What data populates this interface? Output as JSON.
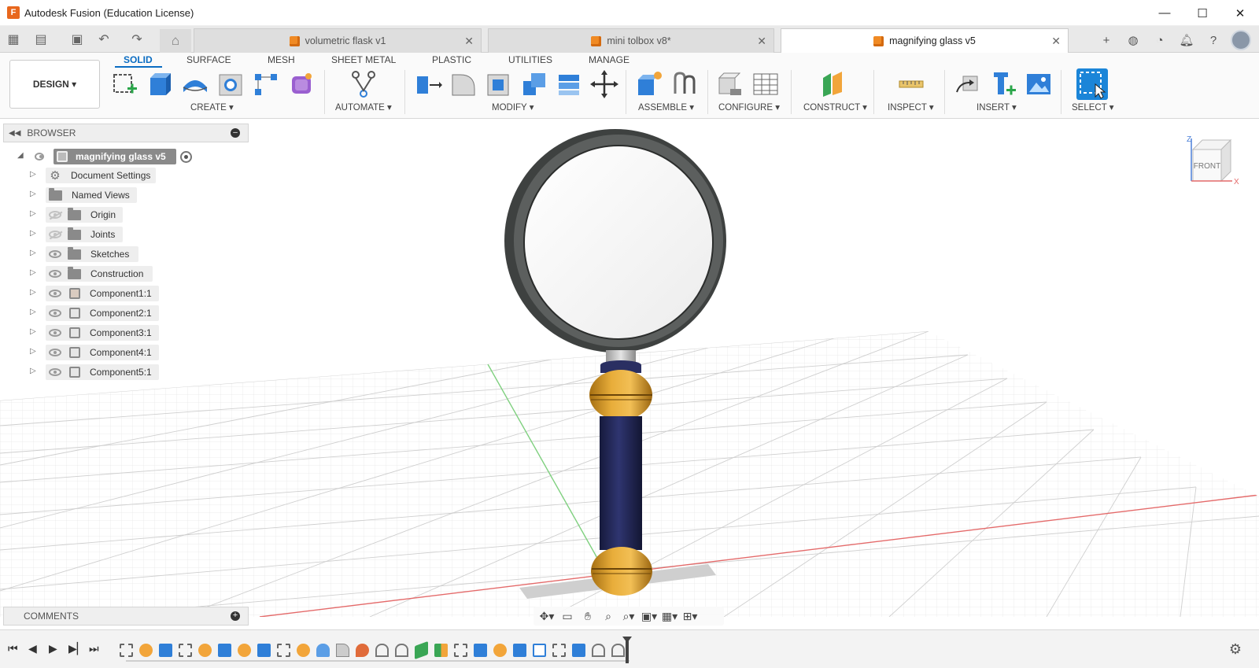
{
  "window": {
    "app_logo": "F",
    "title": "Autodesk Fusion (Education License)",
    "controls": {
      "minimize": "—",
      "maximize": "☐",
      "close": "✕"
    }
  },
  "tabs": [
    {
      "label": "volumetric flask v1",
      "active": false
    },
    {
      "label": "mini tolbox v8*",
      "active": false
    },
    {
      "label": "magnifying glass v5",
      "active": true
    }
  ],
  "toolbar": {
    "workspace": "DESIGN ▾",
    "tabs": [
      "SOLID",
      "SURFACE",
      "MESH",
      "SHEET METAL",
      "PLASTIC",
      "UTILITIES",
      "MANAGE"
    ],
    "active_tab": "SOLID",
    "groups": [
      "CREATE ▾",
      "AUTOMATE ▾",
      "MODIFY ▾",
      "ASSEMBLE ▾",
      "CONFIGURE ▾",
      "CONSTRUCT ▾",
      "INSPECT ▾",
      "INSERT ▾",
      "SELECT ▾"
    ]
  },
  "browser": {
    "title": "BROWSER",
    "root": "magnifying glass v5",
    "items": [
      {
        "label": "Document Settings",
        "type": "settings",
        "visible": null
      },
      {
        "label": "Named Views",
        "type": "folder",
        "visible": null
      },
      {
        "label": "Origin",
        "type": "folder",
        "visible": false
      },
      {
        "label": "Joints",
        "type": "folder",
        "visible": false
      },
      {
        "label": "Sketches",
        "type": "folder",
        "visible": true
      },
      {
        "label": "Construction",
        "type": "folder",
        "visible": true
      },
      {
        "label": "Component1:1",
        "type": "component",
        "visible": true
      },
      {
        "label": "Component2:1",
        "type": "component",
        "visible": true
      },
      {
        "label": "Component3:1",
        "type": "component",
        "visible": true
      },
      {
        "label": "Component4:1",
        "type": "component",
        "visible": true
      },
      {
        "label": "Component5:1",
        "type": "component",
        "visible": true
      }
    ]
  },
  "viewcube": {
    "face": "FRONT",
    "axis_z": "Z",
    "axis_x": "X"
  },
  "comments": {
    "title": "COMMENTS"
  },
  "colors": {
    "accent": "#0a6cc2",
    "ring": "#3e4140",
    "gold": "#d99a28",
    "handle": "#262a58",
    "grid_axis_red": "#e46a6a",
    "grid_axis_green": "#7fd07f"
  }
}
